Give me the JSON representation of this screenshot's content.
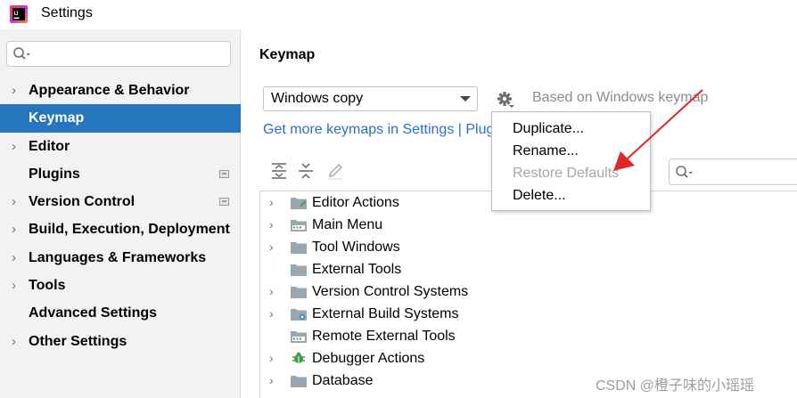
{
  "window": {
    "title": "Settings"
  },
  "sidebar": {
    "search_placeholder": "",
    "items": [
      {
        "label": "Appearance & Behavior",
        "expandable": true,
        "selected": false,
        "badge": false
      },
      {
        "label": "Keymap",
        "expandable": false,
        "selected": true,
        "badge": false
      },
      {
        "label": "Editor",
        "expandable": true,
        "selected": false,
        "badge": false
      },
      {
        "label": "Plugins",
        "expandable": false,
        "selected": false,
        "badge": true
      },
      {
        "label": "Version Control",
        "expandable": true,
        "selected": false,
        "badge": true
      },
      {
        "label": "Build, Execution, Deployment",
        "expandable": true,
        "selected": false,
        "badge": false
      },
      {
        "label": "Languages & Frameworks",
        "expandable": true,
        "selected": false,
        "badge": false
      },
      {
        "label": "Tools",
        "expandable": true,
        "selected": false,
        "badge": false
      },
      {
        "label": "Advanced Settings",
        "expandable": false,
        "selected": false,
        "badge": false
      },
      {
        "label": "Other Settings",
        "expandable": true,
        "selected": false,
        "badge": false
      }
    ]
  },
  "main": {
    "title": "Keymap",
    "keymap_select_value": "Windows copy",
    "based_on": "Based on Windows keymap",
    "more_link": "Get more keymaps in Settings | Plug",
    "tree": [
      {
        "label": "Editor Actions",
        "expandable": true,
        "icon": "folder-edit-icon"
      },
      {
        "label": "Main Menu",
        "expandable": true,
        "icon": "folder-menu-icon"
      },
      {
        "label": "Tool Windows",
        "expandable": true,
        "icon": "folder-icon"
      },
      {
        "label": "External Tools",
        "expandable": false,
        "icon": "folder-icon"
      },
      {
        "label": "Version Control Systems",
        "expandable": true,
        "icon": "folder-icon"
      },
      {
        "label": "External Build Systems",
        "expandable": true,
        "icon": "folder-gear-icon"
      },
      {
        "label": "Remote External Tools",
        "expandable": false,
        "icon": "folder-menu-icon"
      },
      {
        "label": "Debugger Actions",
        "expandable": true,
        "icon": "bug-icon"
      },
      {
        "label": "Database",
        "expandable": true,
        "icon": "folder-icon"
      }
    ]
  },
  "popup_menu": {
    "items": [
      {
        "label": "Duplicate...",
        "disabled": false
      },
      {
        "label": "Rename...",
        "disabled": false
      },
      {
        "label": "Restore Defaults",
        "disabled": true
      },
      {
        "label": "Delete...",
        "disabled": false
      }
    ]
  },
  "watermark": "CSDN @橙子味的小瑶瑶",
  "colors": {
    "accent": "#2675bf",
    "link": "#2a70c9",
    "annotation": "#e0252b"
  }
}
